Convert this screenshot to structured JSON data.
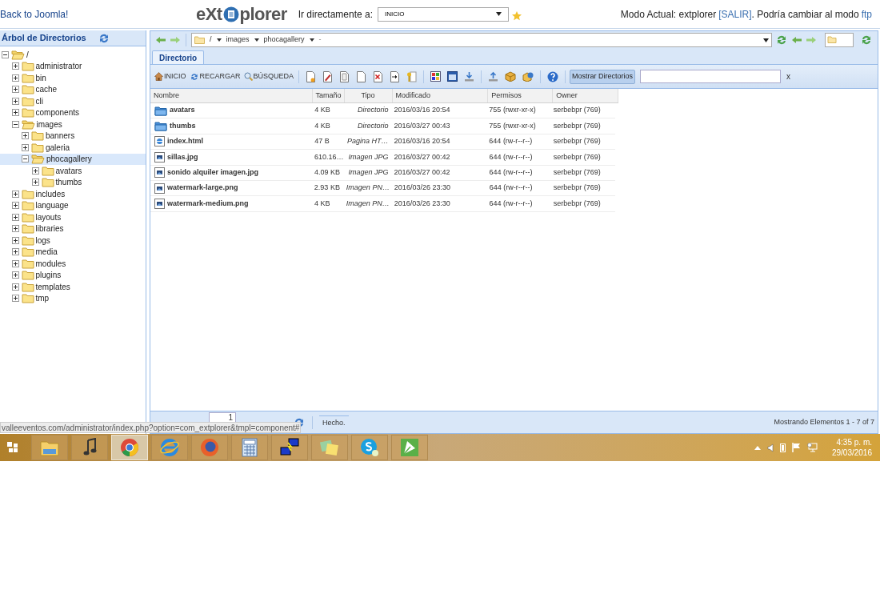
{
  "header": {
    "back_link": "Back to Joomla!",
    "logo_left": "eXt",
    "logo_right": "plorer",
    "goto_label": "Ir directamente a:",
    "goto_value": "INICIO",
    "mode_text": "Modo Actual: extplorer",
    "logout_link": "[SALIR]",
    "switch_text": ". Podría cambiar al modo",
    "ftp_link": "ftp"
  },
  "tree": {
    "title": "Árbol de Directorios",
    "items": [
      {
        "label": "/",
        "expanded": true,
        "selected": false,
        "children": [
          {
            "label": "administrator",
            "expanded": false,
            "selected": false
          },
          {
            "label": "bin",
            "expanded": false,
            "selected": false
          },
          {
            "label": "cache",
            "expanded": false,
            "selected": false
          },
          {
            "label": "cli",
            "expanded": false,
            "selected": false
          },
          {
            "label": "components",
            "expanded": false,
            "selected": false
          },
          {
            "label": "images",
            "expanded": true,
            "selected": false,
            "children": [
              {
                "label": "banners",
                "expanded": false,
                "selected": false
              },
              {
                "label": "galeria",
                "expanded": false,
                "selected": false
              },
              {
                "label": "phocagallery",
                "expanded": true,
                "selected": true,
                "children": [
                  {
                    "label": "avatars",
                    "expanded": false,
                    "selected": false
                  },
                  {
                    "label": "thumbs",
                    "expanded": false,
                    "selected": false
                  }
                ]
              }
            ]
          },
          {
            "label": "includes",
            "expanded": false,
            "selected": false
          },
          {
            "label": "language",
            "expanded": false,
            "selected": false
          },
          {
            "label": "layouts",
            "expanded": false,
            "selected": false
          },
          {
            "label": "libraries",
            "expanded": false,
            "selected": false
          },
          {
            "label": "logs",
            "expanded": false,
            "selected": false
          },
          {
            "label": "media",
            "expanded": false,
            "selected": false
          },
          {
            "label": "modules",
            "expanded": false,
            "selected": false
          },
          {
            "label": "plugins",
            "expanded": false,
            "selected": false
          },
          {
            "label": "templates",
            "expanded": false,
            "selected": false
          },
          {
            "label": "tmp",
            "expanded": false,
            "selected": false
          }
        ]
      }
    ]
  },
  "path": {
    "segments": [
      "/",
      "images",
      "phocagallery"
    ],
    "end_mark": "-"
  },
  "tabs": [
    {
      "label": "Directorio",
      "selected": true
    }
  ],
  "toolbar": {
    "buttons": [
      {
        "label": "INICIO",
        "kind": "home"
      },
      {
        "label": "RECARGAR",
        "kind": "reload"
      },
      {
        "label": "BÚSQUEDA",
        "kind": "search"
      }
    ],
    "toggle": {
      "label": "Mostrar Directorios",
      "on": true
    },
    "clear": "x"
  },
  "table": {
    "columns": [
      "Nombre",
      "Tamaño",
      "Tipo",
      "Modificado",
      "Permisos",
      "Owner"
    ],
    "rows": [
      {
        "kind": "folder",
        "name": "avatars",
        "size": "4 KB",
        "type": "Directorio",
        "modified": "2016/03/16 20:54",
        "perms": "755 (rwxr-xr-x)",
        "owner": "serbebpr (769)"
      },
      {
        "kind": "folder",
        "name": "thumbs",
        "size": "4 KB",
        "type": "Directorio",
        "modified": "2016/03/27 00:43",
        "perms": "755 (rwxr-xr-x)",
        "owner": "serbebpr (769)"
      },
      {
        "kind": "html",
        "name": "index.html",
        "size": "47 B",
        "type": "Pagina HT…",
        "modified": "2016/03/16 20:54",
        "perms": "644 (rw-r--r--)",
        "owner": "serbebpr (769)"
      },
      {
        "kind": "image",
        "name": "sillas.jpg",
        "size": "610.16…",
        "type": "Imagen JPG",
        "modified": "2016/03/27 00:42",
        "perms": "644 (rw-r--r--)",
        "owner": "serbebpr (769)"
      },
      {
        "kind": "image",
        "name": "sonido alquiler imagen.jpg",
        "size": "4.09 KB",
        "type": "Imagen JPG",
        "modified": "2016/03/27 00:42",
        "perms": "644 (rw-r--r--)",
        "owner": "serbebpr (769)"
      },
      {
        "kind": "image",
        "name": "watermark-large.png",
        "size": "2.93 KB",
        "type": "Imagen PN…",
        "modified": "2016/03/26 23:30",
        "perms": "644 (rw-r--r--)",
        "owner": "serbebpr (769)"
      },
      {
        "kind": "image",
        "name": "watermark-medium.png",
        "size": "4 KB",
        "type": "Imagen PN…",
        "modified": "2016/03/26 23:30",
        "perms": "644 (rw-r--r--)",
        "owner": "serbebpr (769)"
      }
    ]
  },
  "paging": {
    "page": "1",
    "status": "Hecho.",
    "summary": "Mostrando Elementos 1 - 7 of 7"
  },
  "status_tooltip": "valleeventos.com/administrator/index.php?option=com_extplorer&tmpl=component#",
  "taskbar": {
    "apps": [
      {
        "kind": "explorer",
        "selected": false
      },
      {
        "kind": "music",
        "selected": false
      },
      {
        "kind": "chrome",
        "selected": true
      },
      {
        "kind": "ie",
        "selected": false
      },
      {
        "kind": "firefox",
        "selected": false
      },
      {
        "kind": "calculator",
        "selected": false
      },
      {
        "kind": "network",
        "selected": false
      },
      {
        "kind": "notes",
        "selected": false
      },
      {
        "kind": "skype",
        "selected": false
      },
      {
        "kind": "draw",
        "selected": false
      }
    ],
    "time": "4:35 p. m.",
    "date": "29/03/2016"
  }
}
